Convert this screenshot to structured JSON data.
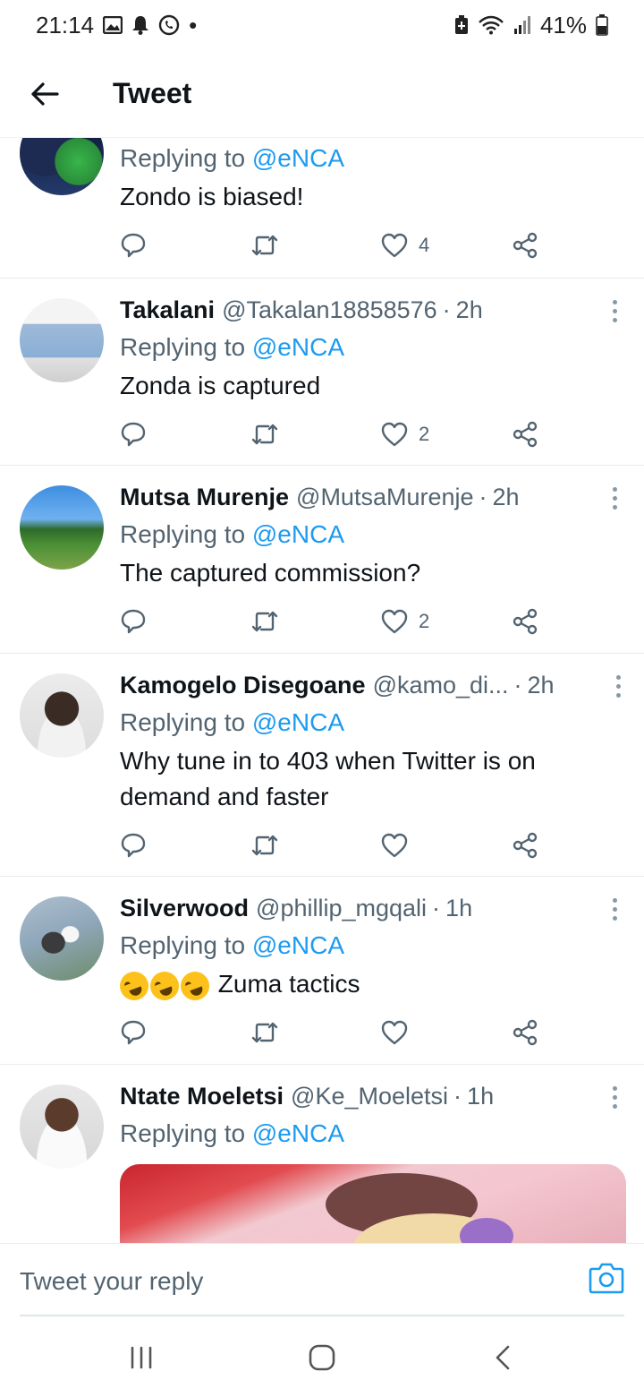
{
  "status_bar": {
    "time": "21:14",
    "battery_percent": "41%",
    "notification_dot": "•"
  },
  "header": {
    "title": "Tweet"
  },
  "tweets": [
    {
      "author_name": "",
      "handle": "",
      "time": "",
      "replying_prefix": "Replying to ",
      "replying_to": "@eNCA",
      "text": "Zondo is biased!",
      "likes": "4"
    },
    {
      "author_name": "Takalani",
      "handle": "@Takalan18858576",
      "time": "2h",
      "replying_prefix": "Replying to ",
      "replying_to": "@eNCA",
      "text": "Zonda is captured",
      "likes": "2"
    },
    {
      "author_name": "Mutsa Murenje",
      "handle": "@MutsaMurenje",
      "time": "2h",
      "replying_prefix": "Replying to ",
      "replying_to": "@eNCA",
      "text": "The captured commission?",
      "likes": "2"
    },
    {
      "author_name": "Kamogelo Disegoane",
      "handle": "@kamo_di...",
      "time": "2h",
      "replying_prefix": "Replying to ",
      "replying_to": "@eNCA",
      "text_line1": "Why tune in to 403 when Twitter is on",
      "text_line2": "demand and faster",
      "likes": ""
    },
    {
      "author_name": "Silverwood",
      "handle": "@phillip_mgqali",
      "time": "1h",
      "replying_prefix": "Replying to ",
      "replying_to": "@eNCA",
      "text": " Zuma tactics",
      "emoji": "rolling-on-floor-laughing",
      "likes": ""
    },
    {
      "author_name": "Ntate Moeletsi",
      "handle": "@Ke_Moeletsi",
      "time": "1h",
      "replying_prefix": "Replying to ",
      "replying_to": "@eNCA"
    }
  ],
  "reply_bar": {
    "placeholder": "Tweet your reply"
  },
  "colors": {
    "accent": "#1d9bf0",
    "secondary_text": "#536471",
    "primary_text": "#0f1419"
  },
  "icons": {
    "back": "arrow-left-icon",
    "reply": "speech-bubble-icon",
    "retweet": "retweet-icon",
    "like": "heart-icon",
    "share": "share-icon",
    "more": "more-vertical-icon",
    "camera": "camera-icon"
  }
}
